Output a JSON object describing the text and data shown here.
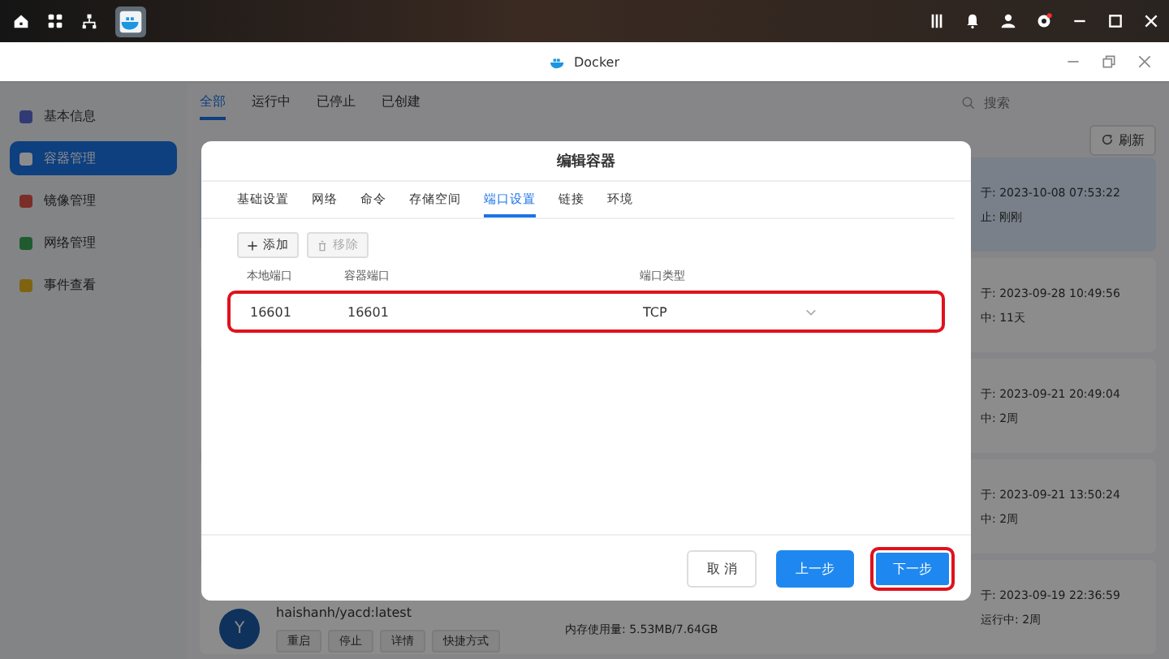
{
  "window": {
    "title": "Docker"
  },
  "sidebar": {
    "items": [
      {
        "label": "基本信息",
        "selected": false
      },
      {
        "label": "容器管理",
        "selected": true
      },
      {
        "label": "镜像管理",
        "selected": false
      },
      {
        "label": "网络管理",
        "selected": false
      },
      {
        "label": "事件查看",
        "selected": false
      }
    ]
  },
  "filter_tabs": [
    {
      "label": "全部",
      "selected": true
    },
    {
      "label": "运行中",
      "selected": false
    },
    {
      "label": "已停止",
      "selected": false
    },
    {
      "label": "已创建",
      "selected": false
    }
  ],
  "search": {
    "placeholder": "搜索"
  },
  "refresh_button": "刷新",
  "containers": [
    {
      "created": "于: 2023-10-08 07:53:22",
      "status": "止: 刚刚",
      "selected": true
    },
    {
      "created": "于: 2023-09-28 10:49:56",
      "status": "中: 11天",
      "selected": false
    },
    {
      "created": "于: 2023-09-21 20:49:04",
      "status": "中: 2周",
      "selected": false
    },
    {
      "created": "于: 2023-09-21 13:50:24",
      "status": "中: 2周",
      "selected": false
    },
    {
      "created": "于: 2023-09-19 22:36:59",
      "status": "运行中: 2周",
      "selected": false,
      "avatar": "Y",
      "image": "haishanh/yacd:latest",
      "memory": "内存使用量: 5.53MB/7.64GB",
      "actions": [
        "重启",
        "停止",
        "详情",
        "快捷方式"
      ]
    }
  ],
  "dialog": {
    "title": "编辑容器",
    "tabs": [
      {
        "label": "基础设置",
        "selected": false
      },
      {
        "label": "网络",
        "selected": false
      },
      {
        "label": "命令",
        "selected": false
      },
      {
        "label": "存储空间",
        "selected": false
      },
      {
        "label": "端口设置",
        "selected": true
      },
      {
        "label": "链接",
        "selected": false
      },
      {
        "label": "环境",
        "selected": false
      }
    ],
    "add_button": {
      "label": "添加",
      "disabled": false
    },
    "remove_button": {
      "label": "移除",
      "disabled": true
    },
    "columns": [
      "本地端口",
      "容器端口",
      "端口类型"
    ],
    "rows": [
      {
        "local_port": "16601",
        "container_port": "16601",
        "type": "TCP",
        "highlighted": true
      }
    ],
    "buttons": [
      {
        "label": "取 消",
        "kind": "default",
        "highlighted": false
      },
      {
        "label": "上一步",
        "kind": "primary",
        "highlighted": false
      },
      {
        "label": "下一步",
        "kind": "primary",
        "highlighted": true
      }
    ]
  }
}
